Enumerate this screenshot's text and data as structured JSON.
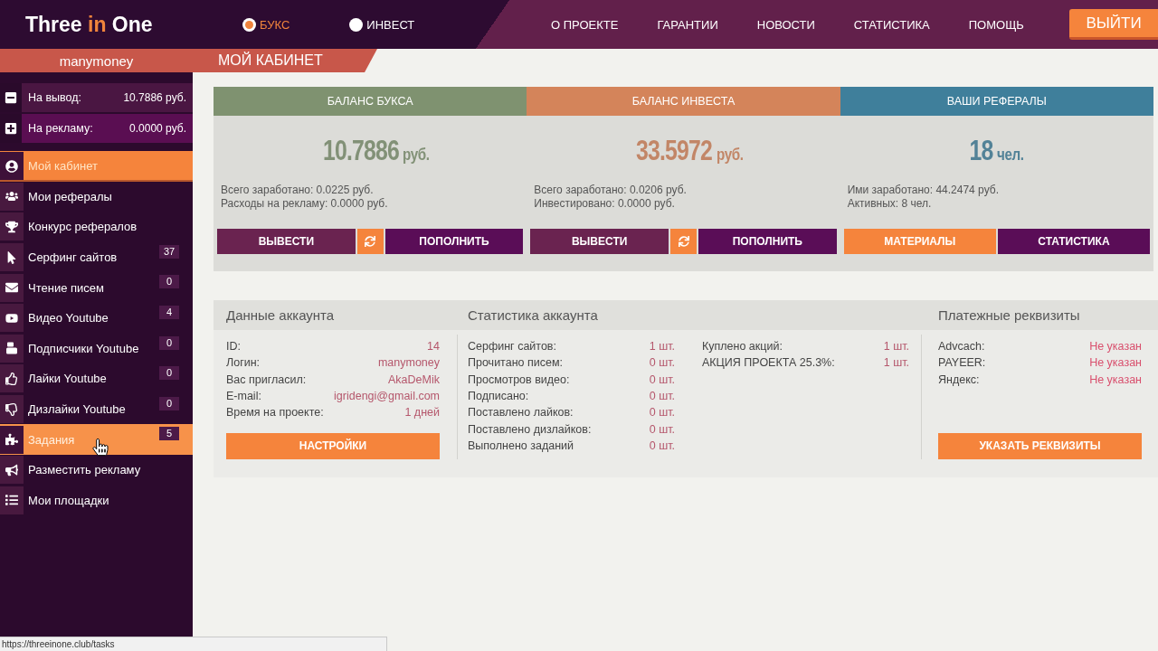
{
  "header": {
    "logo": [
      {
        "text": "Three ",
        "accent": false
      },
      {
        "text": "in",
        "accent": true
      },
      {
        "text": " One",
        "accent": false
      }
    ],
    "modes": [
      {
        "label": "БУКС",
        "selected": true
      },
      {
        "label": "ИНВЕСТ",
        "selected": false
      }
    ],
    "nav": [
      "О ПРОЕКТЕ",
      "ГАРАНТИИ",
      "НОВОСТИ",
      "СТАТИСТИКА",
      "ПОМОЩЬ"
    ],
    "logout_button": "ВЫЙТИ"
  },
  "sidebar": {
    "username": "manymoney",
    "balances": [
      {
        "label": "На вывод:",
        "value": "10.7886 руб."
      },
      {
        "label": "На рекламу:",
        "value": "0.0000 руб."
      }
    ],
    "items": [
      {
        "label": "Мой кабинет",
        "selected": true,
        "hovered": false
      },
      {
        "label": "Мои рефералы",
        "selected": false,
        "hovered": false
      },
      {
        "label": "Конкурс рефералов",
        "selected": false,
        "hovered": false
      },
      {
        "label": "Серфинг сайтов",
        "badge": "37",
        "selected": false,
        "hovered": false
      },
      {
        "label": "Чтение писем",
        "badge": "0",
        "selected": false,
        "hovered": false
      },
      {
        "label": "Видео Youtube",
        "badge": "4",
        "selected": false,
        "hovered": false
      },
      {
        "label": "Подписчики Youtube",
        "badge": "0",
        "selected": false,
        "hovered": false
      },
      {
        "label": "Лайки Youtube",
        "badge": "0",
        "selected": false,
        "hovered": false
      },
      {
        "label": "Дизлайки Youtube",
        "badge": "0",
        "selected": false,
        "hovered": false
      },
      {
        "label": "Задания",
        "badge": "5",
        "selected": false,
        "hovered": true
      },
      {
        "label": "Разместить рекламу",
        "selected": false,
        "hovered": false
      },
      {
        "label": "Мои площадки",
        "selected": false,
        "hovered": false
      }
    ]
  },
  "page_title": "МОЙ КАБИНЕТ",
  "balance_cards": [
    {
      "title": "БАЛАНС БУКСА",
      "color": "#7f9270",
      "amount": "10.7886",
      "unit": "руб.",
      "lines": [
        "Всего заработано: 0.0225 руб.",
        "Расходы на рекламу: 0.0000 руб."
      ],
      "buttons": [
        {
          "kind": "primary",
          "label": "ВЫВЕСТИ"
        },
        {
          "kind": "refresh"
        },
        {
          "kind": "secondary",
          "label": "ПОПОЛНИТЬ"
        }
      ]
    },
    {
      "title": "БАЛАНС ИНВЕСТА",
      "color": "#d4845a",
      "amount": "33.5972",
      "unit": "руб.",
      "lines": [
        "Всего заработано: 0.0206 руб.",
        "Инвестировано: 0.0000 руб."
      ],
      "buttons": [
        {
          "kind": "primary",
          "label": "ВЫВЕСТИ"
        },
        {
          "kind": "refresh"
        },
        {
          "kind": "secondary",
          "label": "ПОПОЛНИТЬ"
        }
      ]
    },
    {
      "title": "ВАШИ РЕФЕРАЛЫ",
      "color": "#3f7f9b",
      "amount": "18",
      "unit": "чел.",
      "lines": [
        "Ими заработано: 44.2474 руб.",
        "Активных: 8 чел."
      ],
      "buttons": [
        {
          "kind": "highlight",
          "label": "МАТЕРИАЛЫ"
        },
        {
          "kind": "secondary",
          "label": "СТАТИСТИКА"
        }
      ]
    }
  ],
  "account_data": {
    "title": "Данные аккаунта",
    "rows": [
      {
        "label": "ID:",
        "value": "14"
      },
      {
        "label": "Логин:",
        "value": "manymoney"
      },
      {
        "label": "Вас пригласил:",
        "value": "AkaDeMik"
      },
      {
        "label": "E-mail:",
        "value": "igridengi@gmail.com"
      },
      {
        "label": "Время на проекте:",
        "value": "1 дней"
      }
    ],
    "button": "НАСТРОЙКИ"
  },
  "account_stats": {
    "title": "Статистика аккаунта",
    "groups": [
      {
        "rows": [
          {
            "label": "Серфинг сайтов:",
            "value": "1 шт."
          },
          {
            "label": "Прочитано писем:",
            "value": "0 шт."
          },
          {
            "label": "Просмотров видео:",
            "value": "0 шт."
          },
          {
            "label": "Подписано:",
            "value": "0 шт."
          },
          {
            "label": "Поставлено лайков:",
            "value": "0 шт."
          },
          {
            "label": "Поставлено дизлайков:",
            "value": "0 шт."
          },
          {
            "label": "Выполнено заданий",
            "value": "0 шт."
          }
        ]
      },
      {
        "rows": [
          {
            "label": "Куплено акций:",
            "value": "1 шт."
          },
          {
            "label": "АКЦИЯ ПРОЕКТА 25.3%:",
            "value": "1 шт."
          }
        ]
      }
    ]
  },
  "payment_details": {
    "title": "Платежные реквизиты",
    "rows": [
      {
        "label": "Advcach:",
        "value": "Не указан"
      },
      {
        "label": "PAYEER:",
        "value": "Не указан"
      },
      {
        "label": "Яндекс:",
        "value": "Не указан"
      }
    ],
    "button": "УКАЗАТЬ РЕКВИЗИТЫ"
  },
  "status_bar": {
    "url": "https://threeinone.club/tasks"
  }
}
